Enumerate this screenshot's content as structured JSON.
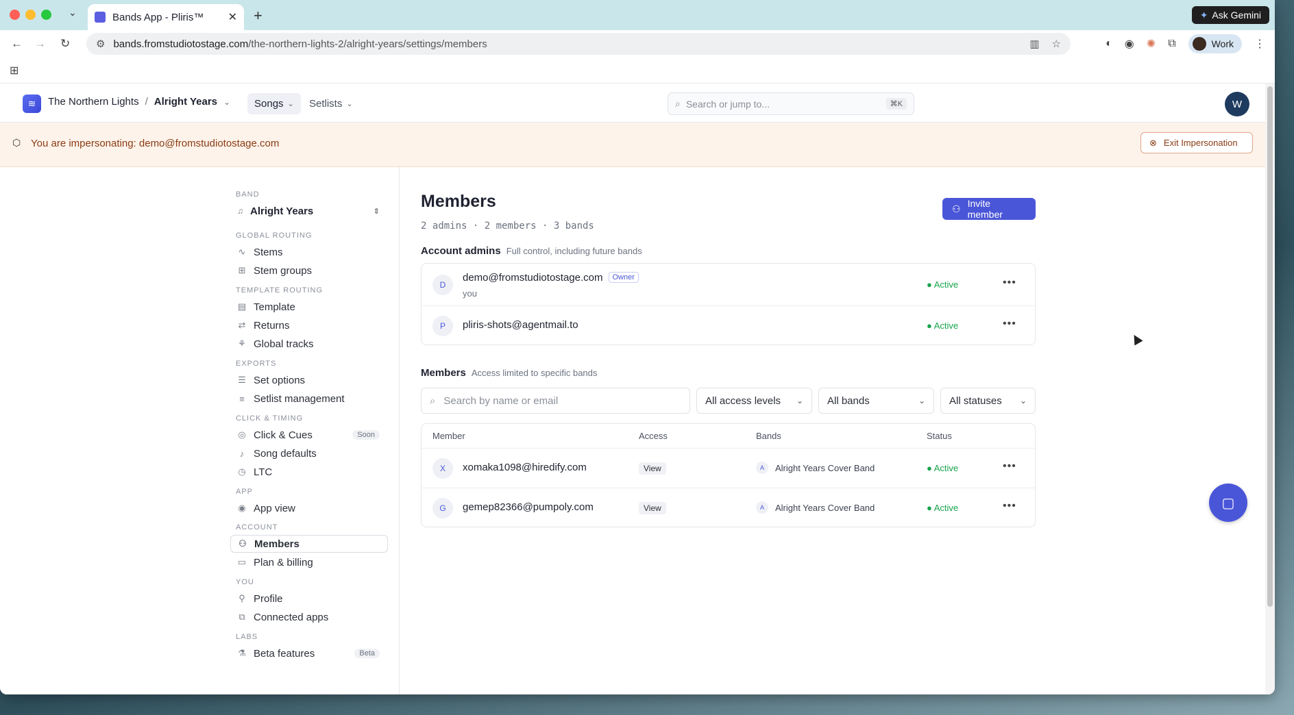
{
  "browser": {
    "tab_title": "Bands App - Pliris™",
    "url_host": "bands.fromstudiotostage.com",
    "url_path": "/the-northern-lights-2/alright-years/settings/members",
    "gemini_label": "Ask Gemini",
    "profile_label": "Work"
  },
  "header": {
    "org": "The Northern Lights",
    "separator": "/",
    "band": "Alright Years",
    "nav_songs": "Songs",
    "nav_setlists": "Setlists",
    "search_placeholder": "Search or jump to...",
    "search_shortcut": "⌘K",
    "user_initial": "W"
  },
  "impersonation": {
    "text": "You are impersonating: demo@fromstudiotostage.com",
    "exit_label": "Exit Impersonation"
  },
  "sidebar": {
    "band_section": "BAND",
    "band_name": "Alright Years",
    "global_routing": "GLOBAL ROUTING",
    "stems": "Stems",
    "stem_groups": "Stem groups",
    "template_routing": "TEMPLATE ROUTING",
    "template": "Template",
    "returns": "Returns",
    "global_tracks": "Global tracks",
    "exports": "EXPORTS",
    "set_options": "Set options",
    "setlist_management": "Setlist management",
    "click_timing": "CLICK & TIMING",
    "click_cues": "Click & Cues",
    "soon": "Soon",
    "song_defaults": "Song defaults",
    "ltc": "LTC",
    "app_section": "APP",
    "app_view": "App view",
    "account": "ACCOUNT",
    "members": "Members",
    "plan_billing": "Plan & billing",
    "you_section": "YOU",
    "profile": "Profile",
    "connected_apps": "Connected apps",
    "labs": "LABS",
    "beta_features": "Beta features",
    "beta": "Beta"
  },
  "main": {
    "title": "Members",
    "subtitle": "2 admins · 2 members · 3 bands",
    "invite_label": "Invite member",
    "admins_heading": "Account admins",
    "admins_desc": "Full control, including future bands",
    "admins": [
      {
        "initial": "D",
        "email": "demo@fromstudiotostage.com",
        "badge": "Owner",
        "note": "you",
        "status": "Active"
      },
      {
        "initial": "P",
        "email": "pliris-shots@agentmail.to",
        "status": "Active"
      }
    ],
    "members_heading": "Members",
    "members_desc": "Access limited to specific bands",
    "search_placeholder": "Search by name or email",
    "filter_access": "All access levels",
    "filter_bands": "All bands",
    "filter_status": "All statuses",
    "columns": {
      "member": "Member",
      "access": "Access",
      "bands": "Bands",
      "status": "Status"
    },
    "members": [
      {
        "initial": "X",
        "email": "xomaka1098@hiredify.com",
        "access": "View",
        "band_initial": "A",
        "band": "Alright Years Cover Band",
        "status": "Active"
      },
      {
        "initial": "G",
        "email": "gemep82366@pumpoly.com",
        "access": "View",
        "band_initial": "A",
        "band": "Alright Years Cover Band",
        "status": "Active"
      }
    ]
  },
  "colors": {
    "accent": "#4a56d8",
    "active": "#16a34a",
    "impersonation_bg": "#fdf3ea"
  }
}
